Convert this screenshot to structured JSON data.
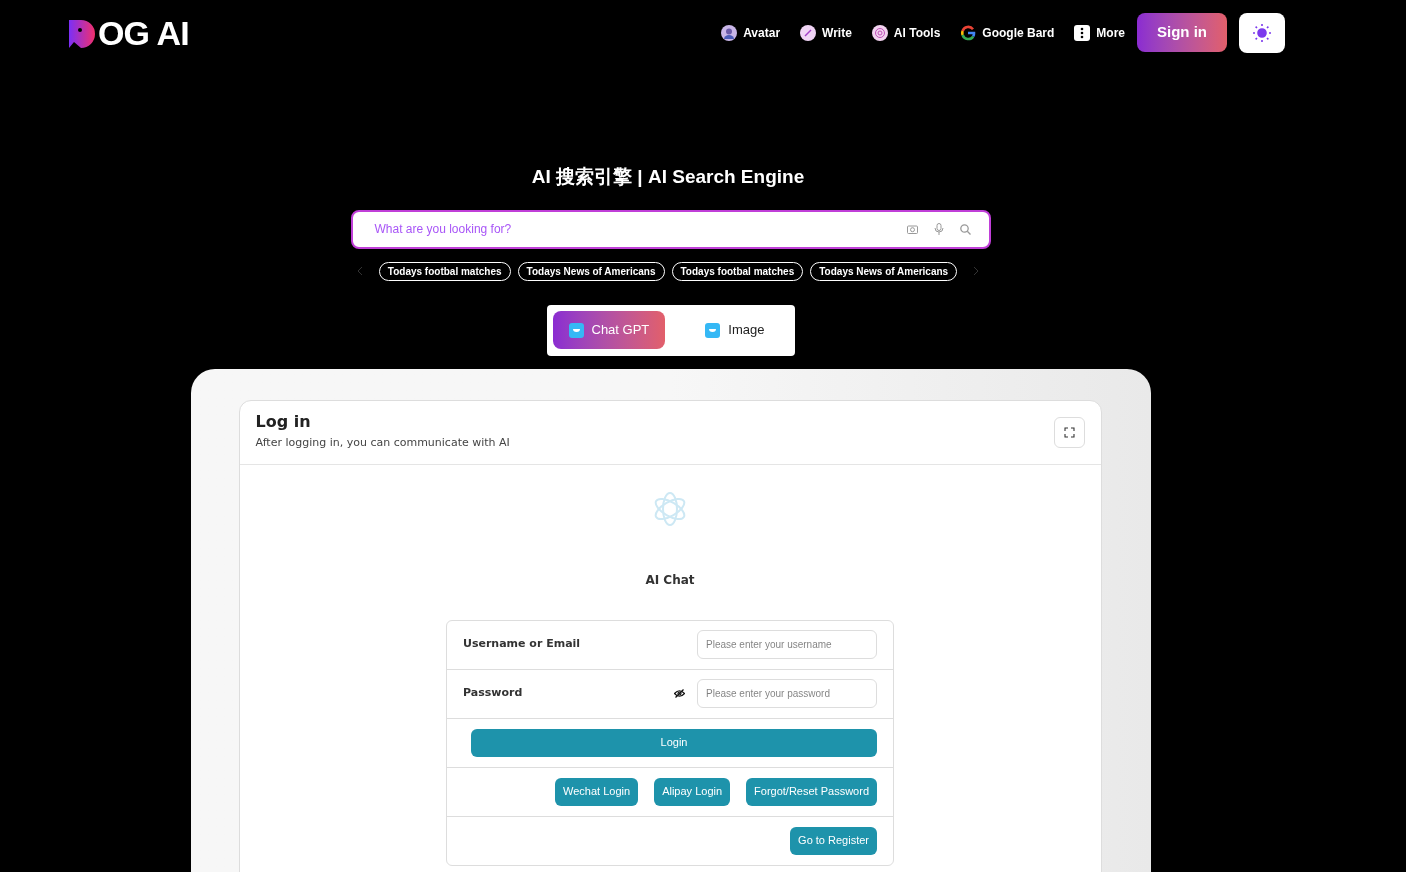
{
  "logo": {
    "text": "OG AI"
  },
  "nav": [
    {
      "label": "Avatar",
      "kind": "avatar"
    },
    {
      "label": "Write",
      "kind": "write"
    },
    {
      "label": "AI Tools",
      "kind": "tools"
    },
    {
      "label": "Google Bard",
      "kind": "bard"
    },
    {
      "label": "More",
      "kind": "more"
    }
  ],
  "sign_in": "Sign in",
  "hero": {
    "title": "AI 搜索引擎 | AI Search Engine"
  },
  "search": {
    "placeholder": "What are you looking for?"
  },
  "suggestions": [
    "Todays footbal matches",
    "Todays News of Americans",
    "Todays footbal matches",
    "Todays News of Americans"
  ],
  "tabs": [
    {
      "label": "Chat GPT",
      "selected": true
    },
    {
      "label": "Image",
      "selected": false
    }
  ],
  "card": {
    "title": "Log in",
    "subtitle": "After logging in, you can communicate with AI",
    "app_name": "AI Chat"
  },
  "form": {
    "fields": [
      {
        "label": "Username or Email",
        "placeholder": "Please enter your username",
        "kind": "text"
      },
      {
        "label": "Password",
        "placeholder": "Please enter your password",
        "kind": "password"
      }
    ],
    "login_button": "Login",
    "alt_buttons": [
      "Wechat Login",
      "Alipay Login",
      "Forgot/Reset Password"
    ],
    "register_button": "Go to Register"
  }
}
